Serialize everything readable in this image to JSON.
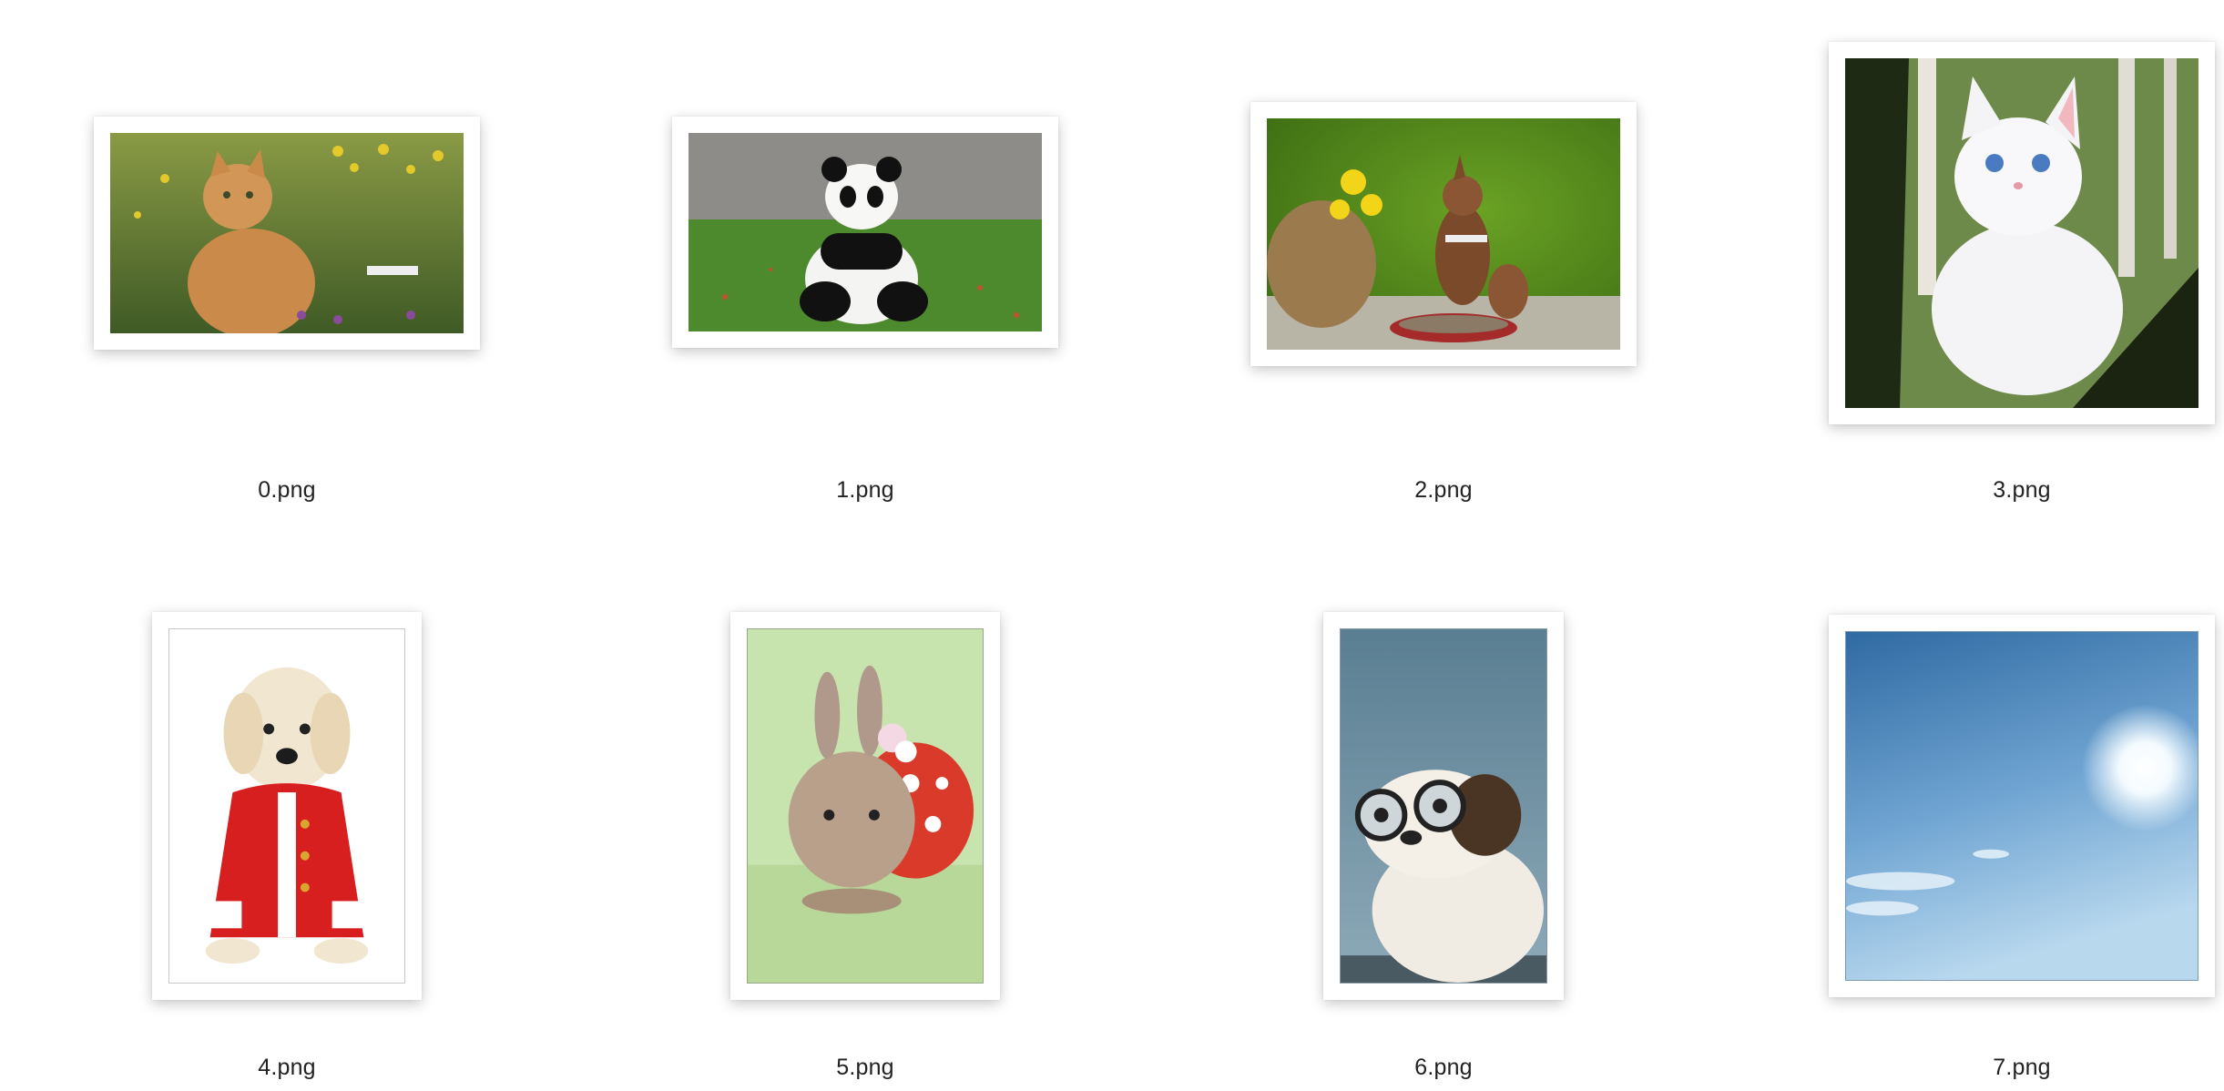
{
  "files": [
    {
      "name": "0.png",
      "thumb": "orange-tabby-cat-in-flowers"
    },
    {
      "name": "1.png",
      "thumb": "panda-sitting-on-grass"
    },
    {
      "name": "2.png",
      "thumb": "squirrel-with-basket"
    },
    {
      "name": "3.png",
      "thumb": "white-kitten-in-forest"
    },
    {
      "name": "4.png",
      "thumb": "puppy-in-red-coat"
    },
    {
      "name": "5.png",
      "thumb": "bunny-with-flower"
    },
    {
      "name": "6.png",
      "thumb": "puppy-with-glasses"
    },
    {
      "name": "7.png",
      "thumb": "blue-sky-with-sun"
    }
  ]
}
